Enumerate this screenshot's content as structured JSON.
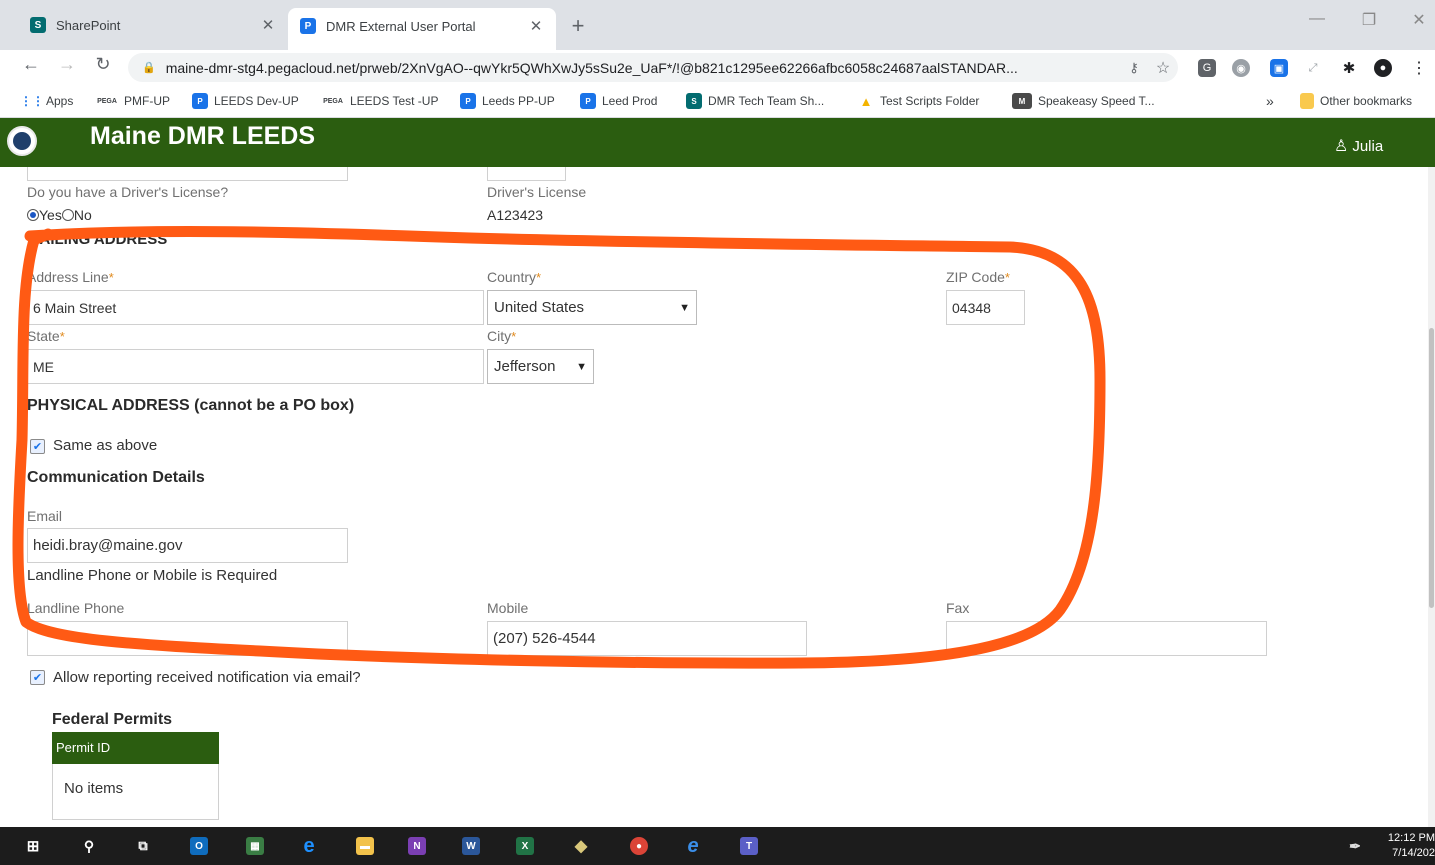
{
  "browser": {
    "tabs": [
      {
        "title": "SharePoint",
        "icon": "sharepoint-icon"
      },
      {
        "title": "DMR External User Portal",
        "icon": "pega-p-icon"
      }
    ],
    "url": "maine-dmr-stg4.pegacloud.net/prweb/2XnVgAO--qwYkr5QWhXwJy5sSu2e_UaF*/!@b821c1295ee62266afbc6058c24687aalSTANDAR...",
    "bookmarks": [
      {
        "label": "Apps",
        "icon": "apps-grid-icon"
      },
      {
        "label": "PMF-UP",
        "icon": "pega-icon"
      },
      {
        "label": "LEEDS Dev-UP",
        "icon": "pega-p-icon"
      },
      {
        "label": "LEEDS Test -UP",
        "icon": "pega-icon"
      },
      {
        "label": "Leeds PP-UP",
        "icon": "pega-p-icon"
      },
      {
        "label": "Leed Prod",
        "icon": "pega-p-icon"
      },
      {
        "label": "DMR Tech Team Sh...",
        "icon": "sharepoint-icon"
      },
      {
        "label": "Test Scripts Folder",
        "icon": "google-drive-icon"
      },
      {
        "label": "Speakeasy Speed T...",
        "icon": "speakeasy-icon"
      }
    ],
    "overflow": "»",
    "other_bookmarks": "Other bookmarks"
  },
  "header": {
    "title": "Maine DMR LEEDS",
    "user": "Julia",
    "color": "#2b5d10"
  },
  "form": {
    "license_question": "Do you have a Driver's License?",
    "yes": "Yes",
    "no": "No",
    "drivers_license_label": "Driver's License",
    "drivers_license_value": "A123423",
    "mailing_title": "MAILING ADDRESS",
    "address_line_label": "Address Line",
    "address_line_value": "6 Main Street",
    "country_label": "Country",
    "country_value": "United States",
    "zip_label": "ZIP Code",
    "zip_value": "04348",
    "state_label": "State",
    "state_value": "ME",
    "city_label": "City",
    "city_value": "Jefferson",
    "physical_title": "PHYSICAL ADDRESS (cannot be a PO box)",
    "same_as_above": "Same as above",
    "comm_title": "Communication Details",
    "email_label": "Email",
    "email_value": "heidi.bray@maine.gov",
    "phone_note": "Landline Phone or Mobile is Required",
    "landline_label": "Landline Phone",
    "landline_value": "",
    "mobile_label": "Mobile",
    "mobile_value": "(207) 526-4544",
    "fax_label": "Fax",
    "fax_value": "",
    "allow_email": "Allow reporting received notification via email?",
    "federal_permits_title": "Federal Permits",
    "permit_id_header": "Permit ID",
    "no_items": "No items",
    "required_marker": "*",
    "required_color": "#e08a1e"
  },
  "annotation": {
    "color": "#ff5a14"
  },
  "taskbar": {
    "time": "12:12 PM",
    "date": "7/14/202"
  }
}
